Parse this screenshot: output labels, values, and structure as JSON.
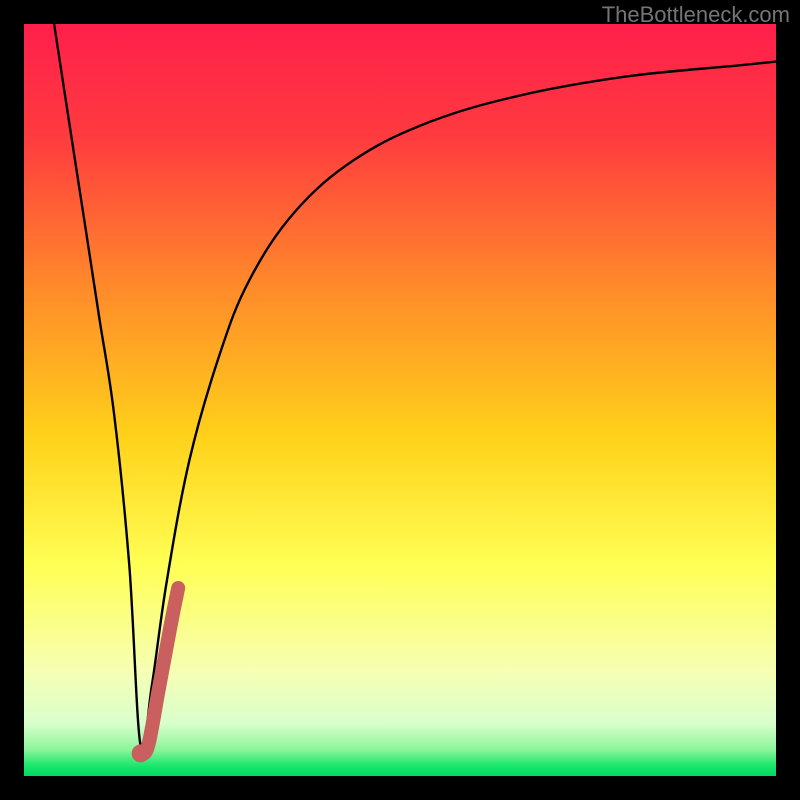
{
  "watermark": {
    "text": "TheBottleneck.com"
  },
  "colors": {
    "black": "#000000",
    "curve": "#000000",
    "highlight": "#c9605f",
    "grad_top": "#ff1f4b",
    "grad_mid1": "#ff7a2a",
    "grad_mid2": "#ffd21a",
    "grad_mid3": "#ffff66",
    "grad_pale": "#f4ffc8",
    "grad_green": "#1ee86f"
  },
  "gradient_stops": [
    {
      "offset": 0.0,
      "color": "#ff1f4b"
    },
    {
      "offset": 0.15,
      "color": "#ff3b3f"
    },
    {
      "offset": 0.35,
      "color": "#ff8a2a"
    },
    {
      "offset": 0.55,
      "color": "#ffd21a"
    },
    {
      "offset": 0.72,
      "color": "#ffff55"
    },
    {
      "offset": 0.86,
      "color": "#f6ffb3"
    },
    {
      "offset": 0.93,
      "color": "#d9ffcc"
    },
    {
      "offset": 0.965,
      "color": "#8cf59a"
    },
    {
      "offset": 0.985,
      "color": "#1ee86f"
    },
    {
      "offset": 1.0,
      "color": "#00d860"
    }
  ],
  "chart_data": {
    "type": "line",
    "title": "",
    "xlabel": "",
    "ylabel": "",
    "xlim": [
      0,
      100
    ],
    "ylim": [
      0,
      100
    ],
    "series": [
      {
        "name": "bottleneck-curve",
        "x": [
          4,
          6,
          8,
          10,
          12,
          14,
          15.5,
          17,
          19,
          22,
          26,
          30,
          36,
          44,
          54,
          66,
          80,
          95,
          100
        ],
        "y": [
          100,
          87,
          74,
          61,
          48,
          28,
          4,
          12,
          26,
          42,
          56,
          66,
          75,
          82,
          87,
          90.5,
          93,
          94.5,
          95
        ]
      },
      {
        "name": "highlight-segment",
        "x": [
          15.5,
          16.5,
          18,
          19.5,
          20.5
        ],
        "y": [
          3,
          4,
          12,
          20,
          25
        ]
      }
    ],
    "marker": {
      "name": "trough",
      "x": 15.5,
      "y": 3
    }
  }
}
